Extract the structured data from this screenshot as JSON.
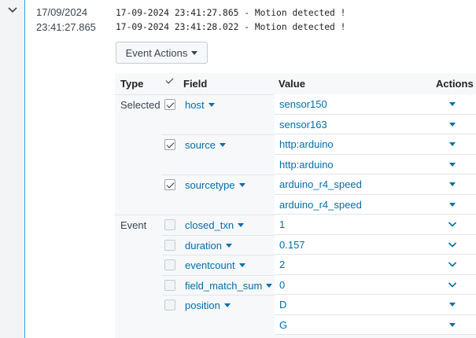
{
  "event": {
    "date": "17/09/2024",
    "time": "23:41:27.865",
    "raw_lines": [
      "17-09-2024 23:41:27.865 - Motion detected !",
      "17-09-2024 23:41:28.022 - Motion detected !"
    ]
  },
  "event_actions_label": "Event Actions",
  "table": {
    "headers": {
      "type": "Type",
      "field": "Field",
      "value": "Value",
      "actions": "Actions"
    },
    "type_labels": {
      "selected": "Selected",
      "event": "Event"
    },
    "selected_fields": [
      {
        "name": "host",
        "values": [
          "sensor150",
          "sensor163"
        ]
      },
      {
        "name": "source",
        "values": [
          "http:arduino",
          "http:arduino"
        ]
      },
      {
        "name": "sourcetype",
        "values": [
          "arduino_r4_speed",
          "arduino_r4_speed"
        ]
      }
    ],
    "event_fields": [
      {
        "name": "closed_txn",
        "values": [
          "1"
        ]
      },
      {
        "name": "duration",
        "values": [
          "0.157"
        ]
      },
      {
        "name": "eventcount",
        "values": [
          "2"
        ]
      },
      {
        "name": "field_match_sum",
        "values": [
          "0"
        ]
      },
      {
        "name": "position",
        "values": [
          "D",
          "G"
        ]
      }
    ]
  },
  "icons": {
    "expand": "chevron-down-icon",
    "checkbox": "checkmark-icon",
    "dropdown": "caret-down-icon"
  },
  "colors": {
    "link": "#006eaa",
    "accent": "#2d9de6",
    "panel": "#f7f8fa"
  }
}
